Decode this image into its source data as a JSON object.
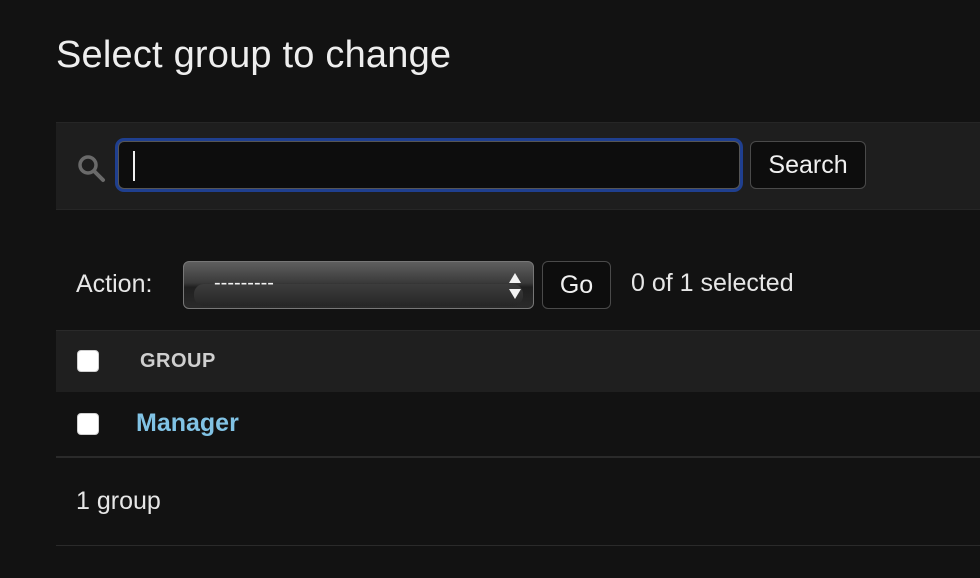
{
  "page": {
    "title": "Select group to change"
  },
  "search": {
    "value": "",
    "button_label": "Search"
  },
  "actions": {
    "label": "Action:",
    "selected_option": "---------",
    "go_label": "Go",
    "selected_count": "0 of 1 selected"
  },
  "table": {
    "columns": [
      "GROUP"
    ],
    "rows": [
      {
        "name": "Manager"
      }
    ]
  },
  "paginator": {
    "text": "1 group"
  },
  "colors": {
    "background": "#121212",
    "toolbar": "#1e1e1e",
    "link": "#81c3e5",
    "focus_ring": "#1f3f8f"
  }
}
